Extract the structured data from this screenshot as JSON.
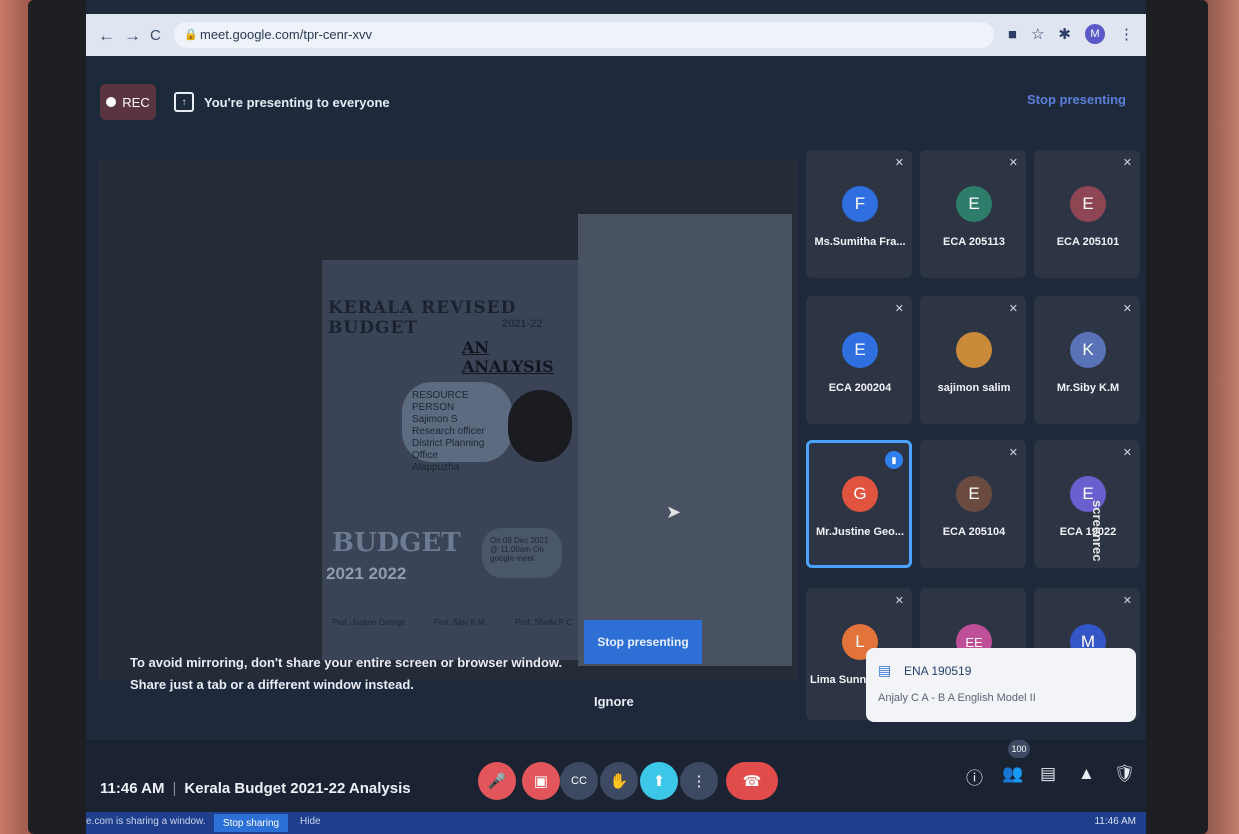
{
  "browser": {
    "url": "meet.google.com/tpr-cenr-xvv",
    "back_icon": "←",
    "forward_icon": "→",
    "reload_icon": "C",
    "profile_initial": "M"
  },
  "header": {
    "rec_label": "REC",
    "presenting_text": "You're presenting to everyone",
    "stop_presenting_link": "Stop presenting"
  },
  "slide": {
    "title": "KERALA REVISED BUDGET",
    "year": "2021-22",
    "subtitle": "AN ANALYSIS",
    "person_lines": [
      "RESOURCE PERSON",
      "Sajimon S",
      "Research officer",
      "District Planning Office",
      "Alappuzha"
    ],
    "budget_word": "BUDGET",
    "budget_years": "2021  2022",
    "info": "On 09 Dec 2021 @ 11.00am On google meet",
    "footer": [
      "Prof. Justine George",
      "Prof. Siby K.M.",
      "Prof. Sheila P C"
    ]
  },
  "presentation": {
    "stop_button": "Stop presenting",
    "warning": "To avoid mirroring, don't share your entire screen or browser window. Share just a tab or a different window instead.",
    "ignore": "Ignore"
  },
  "participants": [
    {
      "initial": "F",
      "name": "Ms.Sumitha Fra...",
      "color": "#2f6fe0"
    },
    {
      "initial": "E",
      "name": "ECA 205113",
      "color": "#2e7d6b"
    },
    {
      "initial": "E",
      "name": "ECA 205101",
      "color": "#8d4652"
    },
    {
      "initial": "E",
      "name": "ECA 200204",
      "color": "#2f6fe0"
    },
    {
      "initial": "",
      "name": "sajimon salim",
      "color": "#c98b3a"
    },
    {
      "initial": "K",
      "name": "Mr.Siby K.M",
      "color": "#5a73b8"
    },
    {
      "initial": "G",
      "name": "Mr.Justine Geo...",
      "color": "#e0533f"
    },
    {
      "initial": "E",
      "name": "ECA 205104",
      "color": "#6b4b40"
    },
    {
      "initial": "E",
      "name": "ECA 19022",
      "color": "#6a5fcf"
    },
    {
      "initial": "L",
      "name": "Lima Sunn",
      "color": "#e2743b"
    },
    {
      "initial": "EE",
      "name": "",
      "color": "#c04f9a"
    },
    {
      "initial": "M",
      "name": "",
      "color": "#3556c6"
    }
  ],
  "notification": {
    "sender": "ENA 190519",
    "message": "Anjaly C A - B A English Model II"
  },
  "watermark": "screenrec",
  "bottom": {
    "time": "11:46 AM",
    "separator": "|",
    "meeting_title": "Kerala Budget 2021-22 Analysis",
    "participant_count": "100",
    "controls": [
      "mic-off",
      "camera-off",
      "captions",
      "raise-hand",
      "present",
      "more",
      "end-call"
    ]
  },
  "taskbar": {
    "sharing_text": "e.com is sharing a window.",
    "stop_sharing": "Stop sharing",
    "hide": "Hide",
    "clock": "11:46 AM"
  },
  "colors": {
    "accent": "#2e6fd6",
    "end_call": "#e24b4b",
    "mic_off": "#e2555a",
    "present": "#3cc7e8"
  }
}
